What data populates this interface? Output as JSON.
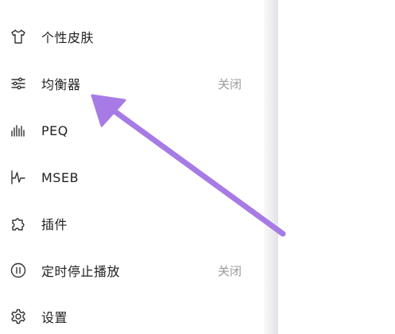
{
  "menu": {
    "items": [
      {
        "id": "skin",
        "label": "个性皮肤",
        "value": "",
        "icon": "tshirt-icon"
      },
      {
        "id": "equalizer",
        "label": "均衡器",
        "value": "关闭",
        "icon": "sliders-icon"
      },
      {
        "id": "peq",
        "label": "PEQ",
        "value": "",
        "icon": "waveform-icon"
      },
      {
        "id": "mseb",
        "label": "MSEB",
        "value": "",
        "icon": "pulse-icon"
      },
      {
        "id": "plugins",
        "label": "插件",
        "value": "",
        "icon": "puzzle-icon"
      },
      {
        "id": "sleep-timer",
        "label": "定时停止播放",
        "value": "关闭",
        "icon": "pause-circle-icon"
      },
      {
        "id": "settings",
        "label": "设置",
        "value": "",
        "icon": "gear-icon"
      }
    ]
  },
  "annotation": {
    "arrow_color": "#a77be6",
    "points_to": "均衡器"
  }
}
